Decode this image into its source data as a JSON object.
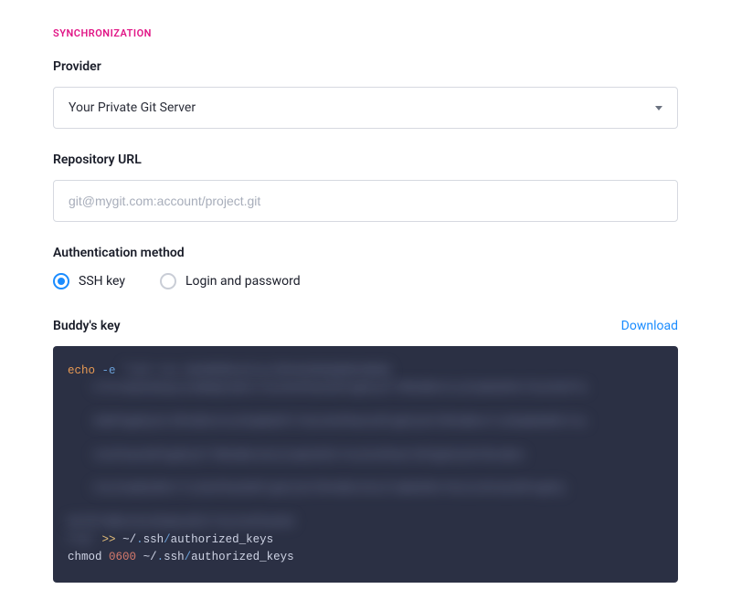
{
  "section": "Synchronization",
  "provider": {
    "label": "Provider",
    "selected": "Your Private Git Server"
  },
  "repo": {
    "label": "Repository URL",
    "placeholder": "git@mygit.com:account/project.git",
    "value": ""
  },
  "auth": {
    "label": "Authentication method",
    "options": {
      "ssh": "SSH key",
      "login": "Login and password"
    },
    "selected": "ssh"
  },
  "key": {
    "label": "Buddy's key",
    "download": "Download",
    "code": {
      "echo": "echo",
      "flag_e": "-e",
      "op_append": ">>",
      "tilde": "~/",
      "dot_ssh": ".",
      "ssh": "ssh",
      "slash": "/",
      "authorized_keys": "authorized_keys",
      "chmod": "chmod",
      "perm": "0600"
    }
  }
}
